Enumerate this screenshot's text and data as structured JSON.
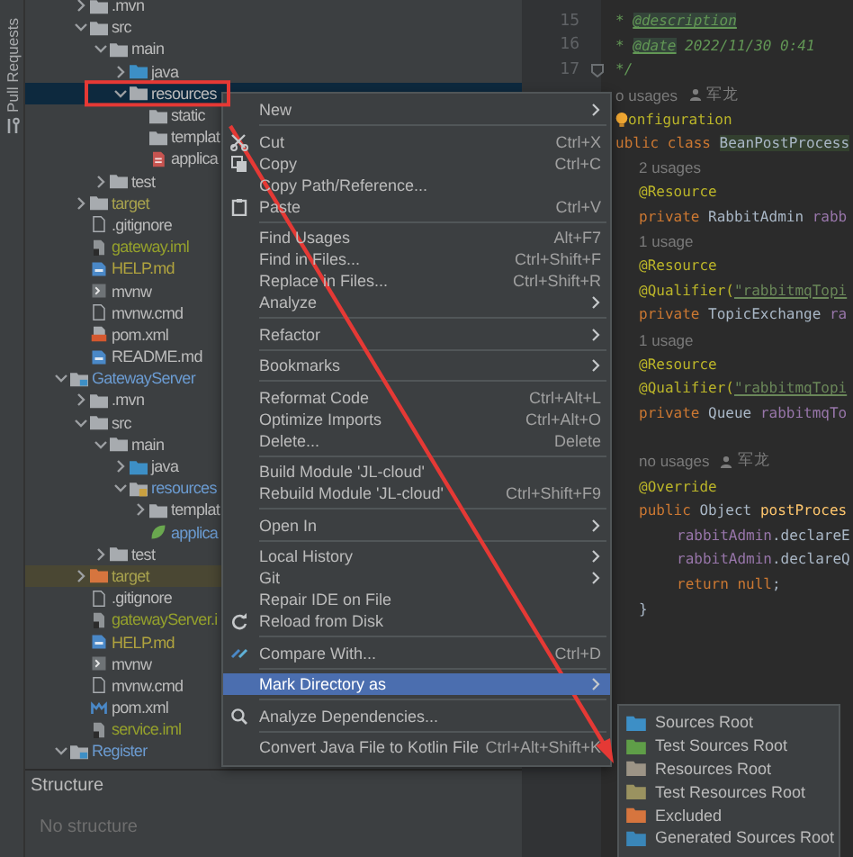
{
  "left_strip": {
    "tool_window_tab": "Pull Requests"
  },
  "project_tree": {
    "partial_module_children": [
      {
        "label": ".mvn",
        "kind": "folder",
        "expanded": false,
        "selected": false,
        "highlighted": false
      },
      {
        "label": "src",
        "kind": "folder",
        "expanded": true,
        "selected": false,
        "highlighted": false,
        "children": [
          {
            "label": "main",
            "kind": "folder",
            "expanded": true,
            "selected": false,
            "highlighted": false,
            "children": [
              {
                "label": "java",
                "kind": "source-folder",
                "expanded": false,
                "selected": false,
                "highlighted": false
              },
              {
                "label": "resources",
                "kind": "folder",
                "expanded": true,
                "selected": true,
                "highlighted": false,
                "children": [
                  {
                    "label": "static",
                    "kind": "folder",
                    "selected": false,
                    "highlighted": false
                  },
                  {
                    "label": "templat",
                    "kind": "folder",
                    "selected": false,
                    "highlighted": false
                  },
                  {
                    "label": "applica",
                    "kind": "yaml-file",
                    "selected": false,
                    "highlighted": false
                  }
                ]
              }
            ]
          },
          {
            "label": "test",
            "kind": "folder",
            "expanded": false,
            "selected": false,
            "highlighted": false
          }
        ]
      },
      {
        "label": "target",
        "kind": "folder",
        "expanded": false,
        "selected": false,
        "highlighted": false,
        "color": "#a8a24e"
      },
      {
        "label": ".gitignore",
        "kind": "text-file",
        "selected": false,
        "highlighted": false
      },
      {
        "label": "gateway.iml",
        "kind": "iml-file",
        "selected": false,
        "highlighted": false,
        "color": "#94a02c"
      },
      {
        "label": "HELP.md",
        "kind": "markdown-file",
        "selected": false,
        "highlighted": false,
        "color": "#b0a33e"
      },
      {
        "label": "mvnw",
        "kind": "script-file",
        "selected": false,
        "highlighted": false
      },
      {
        "label": "mvnw.cmd",
        "kind": "text-file",
        "selected": false,
        "highlighted": false
      },
      {
        "label": "pom.xml",
        "kind": "xml-file",
        "selected": false,
        "highlighted": false
      },
      {
        "label": "README.md",
        "kind": "markdown-file",
        "selected": false,
        "highlighted": false
      }
    ],
    "modules": [
      {
        "label": "GatewayServer",
        "kind": "module",
        "expanded": true,
        "selected": false,
        "highlighted": false,
        "color": "#6b9bd1",
        "children": [
          {
            "label": ".mvn",
            "kind": "folder",
            "expanded": false,
            "selected": false,
            "highlighted": false
          },
          {
            "label": "src",
            "kind": "folder",
            "expanded": true,
            "selected": false,
            "highlighted": false,
            "children": [
              {
                "label": "main",
                "kind": "folder",
                "expanded": true,
                "selected": false,
                "highlighted": false,
                "children": [
                  {
                    "label": "java",
                    "kind": "source-folder",
                    "expanded": false,
                    "selected": false,
                    "highlighted": false
                  },
                  {
                    "label": "resources",
                    "kind": "resource-folder",
                    "expanded": true,
                    "selected": false,
                    "highlighted": false,
                    "color": "#6b9bd1",
                    "children": [
                      {
                        "label": "templat",
                        "kind": "folder",
                        "expanded": false,
                        "selected": false,
                        "highlighted": false
                      },
                      {
                        "label": "applica",
                        "kind": "spring-file",
                        "selected": false,
                        "highlighted": false,
                        "color": "#6b9bd1"
                      }
                    ]
                  }
                ]
              },
              {
                "label": "test",
                "kind": "folder",
                "expanded": false,
                "selected": false,
                "highlighted": false
              }
            ]
          },
          {
            "label": "target",
            "kind": "excluded-folder",
            "expanded": false,
            "selected": false,
            "highlighted": true,
            "color": "#a8a24e"
          },
          {
            "label": ".gitignore",
            "kind": "text-file",
            "selected": false,
            "highlighted": false
          },
          {
            "label": "gatewayServer.i",
            "kind": "iml-file",
            "selected": false,
            "highlighted": false,
            "color": "#94a02c"
          },
          {
            "label": "HELP.md",
            "kind": "markdown-file",
            "selected": false,
            "highlighted": false,
            "color": "#b0a33e"
          },
          {
            "label": "mvnw",
            "kind": "script-file",
            "selected": false,
            "highlighted": false
          },
          {
            "label": "mvnw.cmd",
            "kind": "text-file",
            "selected": false,
            "highlighted": false
          },
          {
            "label": "pom.xml",
            "kind": "maven-file",
            "selected": false,
            "highlighted": false
          },
          {
            "label": "service.iml",
            "kind": "iml-file",
            "selected": false,
            "highlighted": false,
            "color": "#94a02c"
          }
        ]
      },
      {
        "label": "Register",
        "kind": "module",
        "expanded": true,
        "selected": false,
        "highlighted": false,
        "color": "#6b9bd1"
      }
    ]
  },
  "structure_panel": {
    "title": "Structure",
    "empty_text": "No structure"
  },
  "editor": {
    "lines": [
      {
        "kind": "code",
        "number": "15",
        "segments": [
          {
            "kind": "comment",
            "text": "* "
          },
          {
            "kind": "doctag",
            "text": "@description"
          }
        ]
      },
      {
        "kind": "code",
        "number": "16",
        "segments": [
          {
            "kind": "comment",
            "text": "* "
          },
          {
            "kind": "doctag",
            "text": "@date"
          },
          {
            "kind": "comment",
            "text": " 2022/11/30 0:41"
          }
        ]
      },
      {
        "kind": "code",
        "number": "17",
        "fold": true,
        "segments": [
          {
            "kind": "comment",
            "text": "*/"
          }
        ]
      },
      {
        "kind": "hint",
        "text": "o usages",
        "author": "军龙"
      },
      {
        "kind": "code",
        "bulb": true,
        "segments": [
          {
            "kind": "annotation",
            "text": "onfiguration"
          }
        ]
      },
      {
        "kind": "code",
        "segments": [
          {
            "kind": "keyword",
            "text": "ublic class "
          },
          {
            "kind": "classname",
            "text": "BeanPostProcess"
          }
        ],
        "children": [
          {
            "kind": "hint",
            "text": "2 usages"
          },
          {
            "kind": "code",
            "segments": [
              {
                "kind": "annotation",
                "text": "@Resource"
              }
            ]
          },
          {
            "kind": "code",
            "segments": [
              {
                "kind": "keyword",
                "text": "private "
              },
              {
                "kind": "plain",
                "text": "RabbitAdmin "
              },
              {
                "kind": "field",
                "text": "rabb"
              }
            ]
          },
          {
            "kind": "hint",
            "text": "1 usage"
          },
          {
            "kind": "code",
            "segments": [
              {
                "kind": "annotation",
                "text": "@Resource"
              }
            ]
          },
          {
            "kind": "code",
            "segments": [
              {
                "kind": "annotation",
                "text": "@Qualifier("
              },
              {
                "kind": "string",
                "text": "\"rabbitmqTopi"
              }
            ]
          },
          {
            "kind": "code",
            "segments": [
              {
                "kind": "keyword",
                "text": "private "
              },
              {
                "kind": "plain",
                "text": "TopicExchange "
              },
              {
                "kind": "field",
                "text": "ra"
              }
            ]
          },
          {
            "kind": "hint",
            "text": "1 usage"
          },
          {
            "kind": "code",
            "segments": [
              {
                "kind": "annotation",
                "text": "@Resource"
              }
            ]
          },
          {
            "kind": "code",
            "segments": [
              {
                "kind": "annotation",
                "text": "@Qualifier("
              },
              {
                "kind": "string",
                "text": "\"rabbitmqTopi"
              }
            ]
          },
          {
            "kind": "code",
            "segments": [
              {
                "kind": "keyword",
                "text": "private "
              },
              {
                "kind": "plain",
                "text": "Queue "
              },
              {
                "kind": "field",
                "text": "rabbitmqTo"
              }
            ]
          },
          {
            "kind": "blank"
          },
          {
            "kind": "hint",
            "text": "no usages",
            "author": "军龙"
          },
          {
            "kind": "code",
            "segments": [
              {
                "kind": "annotation",
                "text": "@Override"
              }
            ]
          },
          {
            "kind": "code",
            "segments": [
              {
                "kind": "keyword",
                "text": "public "
              },
              {
                "kind": "plain",
                "text": "Object "
              },
              {
                "kind": "method",
                "text": "postProces"
              }
            ],
            "children": [
              {
                "kind": "code",
                "segments": [
                  {
                    "kind": "field",
                    "text": "rabbitAdmin"
                  },
                  {
                    "kind": "plain",
                    "text": ".declareE"
                  }
                ]
              },
              {
                "kind": "code",
                "segments": [
                  {
                    "kind": "field",
                    "text": "rabbitAdmin"
                  },
                  {
                    "kind": "plain",
                    "text": ".declareQ"
                  }
                ]
              },
              {
                "kind": "code",
                "segments": [
                  {
                    "kind": "keyword",
                    "text": "return null"
                  },
                  {
                    "kind": "plain",
                    "text": ";"
                  }
                ]
              }
            ]
          },
          {
            "kind": "code",
            "segments": [
              {
                "kind": "plain",
                "text": "}"
              }
            ]
          }
        ]
      }
    ]
  },
  "context_menu": {
    "items": [
      {
        "kind": "item",
        "label": "New",
        "submenu": true,
        "selected": false
      },
      {
        "kind": "separator"
      },
      {
        "kind": "item",
        "label": "Cut",
        "shortcut": "Ctrl+X",
        "selected": false
      },
      {
        "kind": "item",
        "label": "Copy",
        "shortcut": "Ctrl+C",
        "selected": false
      },
      {
        "kind": "item",
        "label": "Copy Path/Reference...",
        "selected": false
      },
      {
        "kind": "item",
        "label": "Paste",
        "shortcut": "Ctrl+V",
        "selected": false
      },
      {
        "kind": "separator"
      },
      {
        "kind": "item",
        "label": "Find Usages",
        "shortcut": "Alt+F7",
        "selected": false
      },
      {
        "kind": "item",
        "label": "Find in Files...",
        "shortcut": "Ctrl+Shift+F",
        "selected": false
      },
      {
        "kind": "item",
        "label": "Replace in Files...",
        "shortcut": "Ctrl+Shift+R",
        "selected": false
      },
      {
        "kind": "item",
        "label": "Analyze",
        "submenu": true,
        "selected": false
      },
      {
        "kind": "separator"
      },
      {
        "kind": "item",
        "label": "Refactor",
        "submenu": true,
        "selected": false
      },
      {
        "kind": "separator"
      },
      {
        "kind": "item",
        "label": "Bookmarks",
        "submenu": true,
        "selected": false
      },
      {
        "kind": "separator"
      },
      {
        "kind": "item",
        "label": "Reformat Code",
        "shortcut": "Ctrl+Alt+L",
        "selected": false
      },
      {
        "kind": "item",
        "label": "Optimize Imports",
        "shortcut": "Ctrl+Alt+O",
        "selected": false
      },
      {
        "kind": "item",
        "label": "Delete...",
        "shortcut": "Delete",
        "selected": false
      },
      {
        "kind": "separator"
      },
      {
        "kind": "item",
        "label": "Build Module 'JL-cloud'",
        "selected": false
      },
      {
        "kind": "item",
        "label": "Rebuild Module 'JL-cloud'",
        "shortcut": "Ctrl+Shift+F9",
        "selected": false
      },
      {
        "kind": "separator"
      },
      {
        "kind": "item",
        "label": "Open In",
        "submenu": true,
        "selected": false
      },
      {
        "kind": "separator"
      },
      {
        "kind": "item",
        "label": "Local History",
        "submenu": true,
        "selected": false
      },
      {
        "kind": "item",
        "label": "Git",
        "submenu": true,
        "selected": false
      },
      {
        "kind": "item",
        "label": "Repair IDE on File",
        "selected": false
      },
      {
        "kind": "item",
        "label": "Reload from Disk",
        "selected": false
      },
      {
        "kind": "separator"
      },
      {
        "kind": "item",
        "label": "Compare With...",
        "shortcut": "Ctrl+D",
        "selected": false
      },
      {
        "kind": "separator"
      },
      {
        "kind": "item",
        "label": "Mark Directory as",
        "submenu": true,
        "selected": true
      },
      {
        "kind": "separator"
      },
      {
        "kind": "item",
        "label": "Analyze Dependencies...",
        "selected": false
      },
      {
        "kind": "separator"
      },
      {
        "kind": "item",
        "label": "Convert Java File to Kotlin File",
        "shortcut": "Ctrl+Alt+Shift+K",
        "selected": false
      }
    ]
  },
  "mark_directory_submenu": {
    "items": [
      {
        "label": "Sources Root",
        "color": "#3d8fc6"
      },
      {
        "label": "Test Sources Root",
        "color": "#5f9e48"
      },
      {
        "label": "Resources Root",
        "color": "#9c9486"
      },
      {
        "label": "Test Resources Root",
        "color": "#9a9260"
      },
      {
        "label": "Excluded",
        "color": "#d6753e"
      },
      {
        "label": "Generated Sources Root",
        "color": "#3a86b8"
      }
    ]
  }
}
